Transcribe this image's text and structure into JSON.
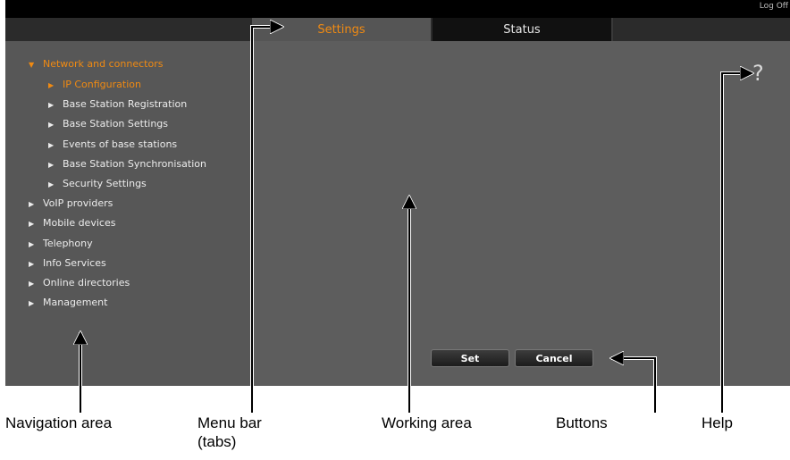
{
  "header": {
    "logoff_label": "Log Off"
  },
  "menu": {
    "tabs": [
      {
        "label": "Settings"
      },
      {
        "label": "Status"
      }
    ]
  },
  "navigation": {
    "items": [
      {
        "label": "Network and connectors"
      },
      {
        "label": "IP Configuration"
      },
      {
        "label": "Base Station Registration"
      },
      {
        "label": "Base Station Settings"
      },
      {
        "label": "Events of base stations"
      },
      {
        "label": "Base Station Synchronisation"
      },
      {
        "label": "Security Settings"
      },
      {
        "label": "VoIP providers"
      },
      {
        "label": "Mobile devices"
      },
      {
        "label": "Telephony"
      },
      {
        "label": "Info Services"
      },
      {
        "label": "Online directories"
      },
      {
        "label": "Management"
      }
    ]
  },
  "help": {
    "symbol": "?"
  },
  "buttons": {
    "set_label": "Set",
    "cancel_label": "Cancel"
  },
  "annotations": {
    "navigation_area": "Navigation area",
    "menu_bar_line1": "Menu bar",
    "menu_bar_line2": "(tabs)",
    "working_area": "Working area",
    "buttons": "Buttons",
    "help": "Help"
  },
  "colors": {
    "accent": "#f08a12",
    "panel": "#5a5a5a",
    "bar": "#000000"
  }
}
